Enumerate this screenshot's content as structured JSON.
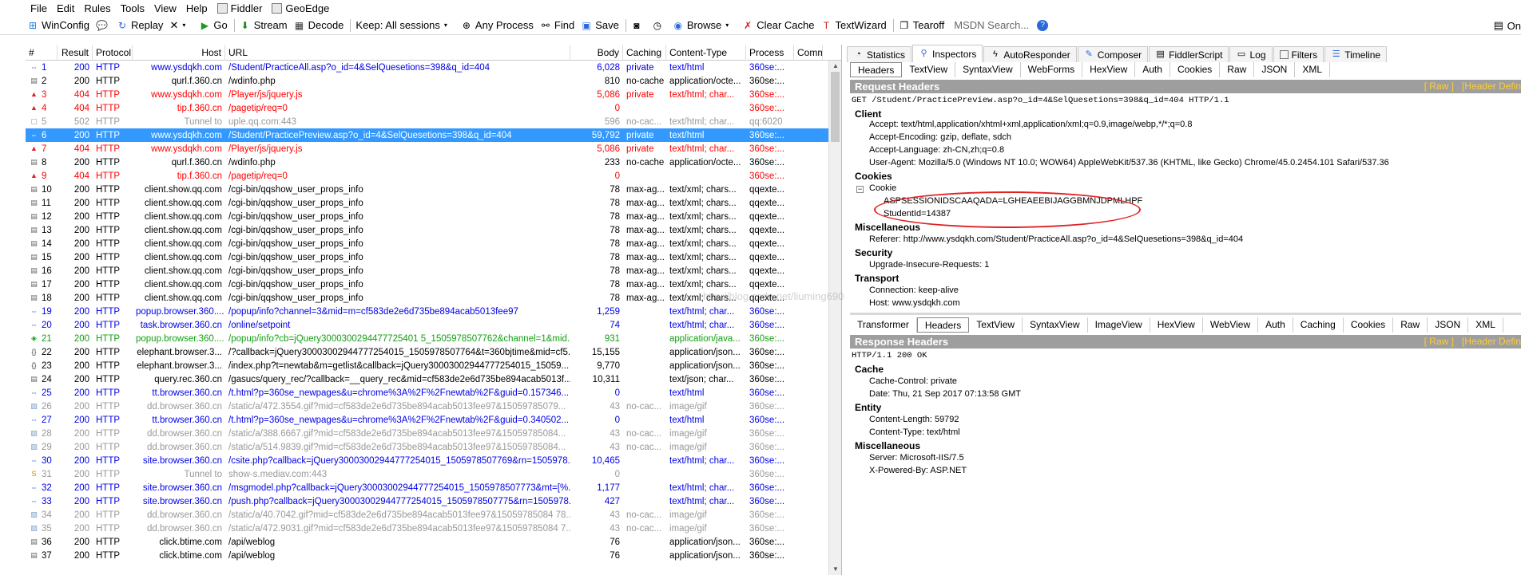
{
  "menu": [
    "File",
    "Edit",
    "Rules",
    "Tools",
    "View",
    "Help",
    "Fiddler",
    "GeoEdge"
  ],
  "toolbar": {
    "winconfig": "WinConfig",
    "replay": "Replay",
    "remove": "✕",
    "go": "Go",
    "stream": "Stream",
    "decode": "Decode",
    "keep": "Keep: All sessions",
    "any_process": "Any Process",
    "find": "Find",
    "save": "Save",
    "browse": "Browse",
    "clear_cache": "Clear Cache",
    "textwizard": "TextWizard",
    "tearoff": "Tearoff",
    "msdn_search": "MSDN Search...",
    "online": "On"
  },
  "sessions": {
    "columns": [
      "#",
      "Result",
      "Protocol",
      "Host",
      "URL",
      "Body",
      "Caching",
      "Content-Type",
      "Process",
      "Comm"
    ],
    "rows": [
      {
        "num": "1",
        "result": "200",
        "proto": "HTTP",
        "host": "www.ysdqkh.com",
        "url": "/Student/PracticeAll.asp?o_id=4&SelQuesetions=398&q_id=404",
        "body": "6,028",
        "caching": "private",
        "ctype": "text/html",
        "proc": "360se:...",
        "color": "blue",
        "icon": "arrows"
      },
      {
        "num": "2",
        "result": "200",
        "proto": "HTTP",
        "host": "qurl.f.360.cn",
        "url": "/wdinfo.php",
        "body": "810",
        "caching": "no-cache",
        "ctype": "application/octe...",
        "proc": "360se:...",
        "color": "black",
        "icon": "doc"
      },
      {
        "num": "3",
        "result": "404",
        "proto": "HTTP",
        "host": "www.ysdqkh.com",
        "url": "/Player/js/jquery.js",
        "body": "5,086",
        "caching": "private",
        "ctype": "text/html; char...",
        "proc": "360se:...",
        "color": "red",
        "icon": "warn"
      },
      {
        "num": "4",
        "result": "404",
        "proto": "HTTP",
        "host": "tip.f.360.cn",
        "url": "/pagetip/req=0",
        "body": "0",
        "caching": "",
        "ctype": "",
        "proc": "360se:...",
        "color": "red",
        "icon": "warn"
      },
      {
        "num": "5",
        "result": "502",
        "proto": "HTTP",
        "host": "Tunnel to",
        "url": "uple.qq.com:443",
        "body": "596",
        "caching": "no-cac...",
        "ctype": "text/html; char...",
        "proc": "qq:6020",
        "color": "gray",
        "icon": "lock"
      },
      {
        "num": "6",
        "result": "200",
        "proto": "HTTP",
        "host": "www.ysdqkh.com",
        "url": "/Student/PracticePreview.asp?o_id=4&SelQuesetions=398&q_id=404",
        "body": "59,792",
        "caching": "private",
        "ctype": "text/html",
        "proc": "360se:...",
        "color": "sel",
        "icon": "arrows"
      },
      {
        "num": "7",
        "result": "404",
        "proto": "HTTP",
        "host": "www.ysdqkh.com",
        "url": "/Player/js/jquery.js",
        "body": "5,086",
        "caching": "private",
        "ctype": "text/html; char...",
        "proc": "360se:...",
        "color": "red",
        "icon": "warn"
      },
      {
        "num": "8",
        "result": "200",
        "proto": "HTTP",
        "host": "qurl.f.360.cn",
        "url": "/wdinfo.php",
        "body": "233",
        "caching": "no-cache",
        "ctype": "application/octe...",
        "proc": "360se:...",
        "color": "black",
        "icon": "doc"
      },
      {
        "num": "9",
        "result": "404",
        "proto": "HTTP",
        "host": "tip.f.360.cn",
        "url": "/pagetip/req=0",
        "body": "0",
        "caching": "",
        "ctype": "",
        "proc": "360se:...",
        "color": "red",
        "icon": "warn"
      },
      {
        "num": "10",
        "result": "200",
        "proto": "HTTP",
        "host": "client.show.qq.com",
        "url": "/cgi-bin/qqshow_user_props_info",
        "body": "78",
        "caching": "max-ag...",
        "ctype": "text/xml; chars...",
        "proc": "qqexte...",
        "color": "black",
        "icon": "doc"
      },
      {
        "num": "11",
        "result": "200",
        "proto": "HTTP",
        "host": "client.show.qq.com",
        "url": "/cgi-bin/qqshow_user_props_info",
        "body": "78",
        "caching": "max-ag...",
        "ctype": "text/xml; chars...",
        "proc": "qqexte...",
        "color": "black",
        "icon": "doc"
      },
      {
        "num": "12",
        "result": "200",
        "proto": "HTTP",
        "host": "client.show.qq.com",
        "url": "/cgi-bin/qqshow_user_props_info",
        "body": "78",
        "caching": "max-ag...",
        "ctype": "text/xml; chars...",
        "proc": "qqexte...",
        "color": "black",
        "icon": "doc"
      },
      {
        "num": "13",
        "result": "200",
        "proto": "HTTP",
        "host": "client.show.qq.com",
        "url": "/cgi-bin/qqshow_user_props_info",
        "body": "78",
        "caching": "max-ag...",
        "ctype": "text/xml; chars...",
        "proc": "qqexte...",
        "color": "black",
        "icon": "doc"
      },
      {
        "num": "14",
        "result": "200",
        "proto": "HTTP",
        "host": "client.show.qq.com",
        "url": "/cgi-bin/qqshow_user_props_info",
        "body": "78",
        "caching": "max-ag...",
        "ctype": "text/xml; chars...",
        "proc": "qqexte...",
        "color": "black",
        "icon": "doc"
      },
      {
        "num": "15",
        "result": "200",
        "proto": "HTTP",
        "host": "client.show.qq.com",
        "url": "/cgi-bin/qqshow_user_props_info",
        "body": "78",
        "caching": "max-ag...",
        "ctype": "text/xml; chars...",
        "proc": "qqexte...",
        "color": "black",
        "icon": "doc"
      },
      {
        "num": "16",
        "result": "200",
        "proto": "HTTP",
        "host": "client.show.qq.com",
        "url": "/cgi-bin/qqshow_user_props_info",
        "body": "78",
        "caching": "max-ag...",
        "ctype": "text/xml; chars...",
        "proc": "qqexte...",
        "color": "black",
        "icon": "doc"
      },
      {
        "num": "17",
        "result": "200",
        "proto": "HTTP",
        "host": "client.show.qq.com",
        "url": "/cgi-bin/qqshow_user_props_info",
        "body": "78",
        "caching": "max-ag...",
        "ctype": "text/xml; chars...",
        "proc": "qqexte...",
        "color": "black",
        "icon": "doc"
      },
      {
        "num": "18",
        "result": "200",
        "proto": "HTTP",
        "host": "client.show.qq.com",
        "url": "/cgi-bin/qqshow_user_props_info",
        "body": "78",
        "caching": "max-ag...",
        "ctype": "text/xml; chars...",
        "proc": "qqexte...",
        "color": "black",
        "icon": "doc"
      },
      {
        "num": "19",
        "result": "200",
        "proto": "HTTP",
        "host": "popup.browser.360....",
        "url": "/popup/info?channel=3&mid=m=cf583de2e6d735be894acab5013fee97",
        "body": "1,259",
        "caching": "",
        "ctype": "text/html; char...",
        "proc": "360se:...",
        "color": "blue",
        "icon": "arrows"
      },
      {
        "num": "20",
        "result": "200",
        "proto": "HTTP",
        "host": "task.browser.360.cn",
        "url": "/online/setpoint",
        "body": "74",
        "caching": "",
        "ctype": "text/html; char...",
        "proc": "360se:...",
        "color": "blue",
        "icon": "arrows"
      },
      {
        "num": "21",
        "result": "200",
        "proto": "HTTP",
        "host": "popup.browser.360....",
        "url": "/popup/info?cb=jQuery3000300294477725401 5_1505978507762&channel=1&mid...",
        "body": "931",
        "caching": "",
        "ctype": "application/java...",
        "proc": "360se:...",
        "color": "green",
        "icon": "js"
      },
      {
        "num": "22",
        "result": "200",
        "proto": "HTTP",
        "host": "elephant.browser.3...",
        "url": "/?callback=jQuery30003002944777254015_1505978507764&t=360bjtime&mid=cf5...",
        "body": "15,155",
        "caching": "",
        "ctype": "application/json...",
        "proc": "360se:...",
        "color": "black",
        "icon": "json"
      },
      {
        "num": "23",
        "result": "200",
        "proto": "HTTP",
        "host": "elephant.browser.3...",
        "url": "/index.php?t=newtab&m=getlist&callback=jQuery30003002944777254015_15059...",
        "body": "9,770",
        "caching": "",
        "ctype": "application/json...",
        "proc": "360se:...",
        "color": "black",
        "icon": "json"
      },
      {
        "num": "24",
        "result": "200",
        "proto": "HTTP",
        "host": "query.rec.360.cn",
        "url": "/gasucs/query_rec/?callback=__query_rec&mid=cf583de2e6d735be894acab5013f...",
        "body": "10,311",
        "caching": "",
        "ctype": "text/json; char...",
        "proc": "360se:...",
        "color": "black",
        "icon": "doc"
      },
      {
        "num": "25",
        "result": "200",
        "proto": "HTTP",
        "host": "tt.browser.360.cn",
        "url": "/t.html?p=360se_newpages&u=chrome%3A%2F%2Fnewtab%2F&guid=0.157346...",
        "body": "0",
        "caching": "",
        "ctype": "text/html",
        "proc": "360se:...",
        "color": "blue",
        "icon": "arrows"
      },
      {
        "num": "26",
        "result": "200",
        "proto": "HTTP",
        "host": "dd.browser.360.cn",
        "url": "/static/a/472.3554.gif?mid=cf583de2e6d735be894acab5013fee97&15059785079...",
        "body": "43",
        "caching": "no-cac...",
        "ctype": "image/gif",
        "proc": "360se:...",
        "color": "gray",
        "icon": "img"
      },
      {
        "num": "27",
        "result": "200",
        "proto": "HTTP",
        "host": "tt.browser.360.cn",
        "url": "/t.html?p=360se_newpages&u=chrome%3A%2F%2Fnewtab%2F&guid=0.340502...",
        "body": "0",
        "caching": "",
        "ctype": "text/html",
        "proc": "360se:...",
        "color": "blue",
        "icon": "arrows"
      },
      {
        "num": "28",
        "result": "200",
        "proto": "HTTP",
        "host": "dd.browser.360.cn",
        "url": "/static/a/388.6667.gif?mid=cf583de2e6d735be894acab5013fee97&15059785084...",
        "body": "43",
        "caching": "no-cac...",
        "ctype": "image/gif",
        "proc": "360se:...",
        "color": "gray",
        "icon": "img"
      },
      {
        "num": "29",
        "result": "200",
        "proto": "HTTP",
        "host": "dd.browser.360.cn",
        "url": "/static/a/514.9839.gif?mid=cf583de2e6d735be894acab5013fee97&15059785084...",
        "body": "43",
        "caching": "no-cac...",
        "ctype": "image/gif",
        "proc": "360se:...",
        "color": "gray",
        "icon": "img"
      },
      {
        "num": "30",
        "result": "200",
        "proto": "HTTP",
        "host": "site.browser.360.cn",
        "url": "/csite.php?callback=jQuery30003002944777254015_1505978507769&rn=1505978...",
        "body": "10,465",
        "caching": "",
        "ctype": "text/html; char...",
        "proc": "360se:...",
        "color": "blue",
        "icon": "arrows"
      },
      {
        "num": "31",
        "result": "200",
        "proto": "HTTP",
        "host": "Tunnel to",
        "url": "show-s.mediav.com:443",
        "body": "0",
        "caching": "",
        "ctype": "",
        "proc": "360se:...",
        "color": "gray",
        "icon": "spdy"
      },
      {
        "num": "32",
        "result": "200",
        "proto": "HTTP",
        "host": "site.browser.360.cn",
        "url": "/msgmodel.php?callback=jQuery30003002944777254015_1505978507773&mt=[%...",
        "body": "1,177",
        "caching": "",
        "ctype": "text/html; char...",
        "proc": "360se:...",
        "color": "blue",
        "icon": "arrows"
      },
      {
        "num": "33",
        "result": "200",
        "proto": "HTTP",
        "host": "site.browser.360.cn",
        "url": "/push.php?callback=jQuery30003002944777254015_1505978507775&rn=1505978...",
        "body": "427",
        "caching": "",
        "ctype": "text/html; char...",
        "proc": "360se:...",
        "color": "blue",
        "icon": "arrows"
      },
      {
        "num": "34",
        "result": "200",
        "proto": "HTTP",
        "host": "dd.browser.360.cn",
        "url": "/static/a/40.7042.gif?mid=cf583de2e6d735be894acab5013fee97&15059785084 78...",
        "body": "43",
        "caching": "no-cac...",
        "ctype": "image/gif",
        "proc": "360se:...",
        "color": "gray",
        "icon": "img"
      },
      {
        "num": "35",
        "result": "200",
        "proto": "HTTP",
        "host": "dd.browser.360.cn",
        "url": "/static/a/472.9031.gif?mid=cf583de2e6d735be894acab5013fee97&15059785084 7...",
        "body": "43",
        "caching": "no-cac...",
        "ctype": "image/gif",
        "proc": "360se:...",
        "color": "gray",
        "icon": "img"
      },
      {
        "num": "36",
        "result": "200",
        "proto": "HTTP",
        "host": "click.btime.com",
        "url": "/api/weblog",
        "body": "76",
        "caching": "",
        "ctype": "application/json...",
        "proc": "360se:...",
        "color": "black",
        "icon": "doc"
      },
      {
        "num": "37",
        "result": "200",
        "proto": "HTTP",
        "host": "click.btime.com",
        "url": "/api/weblog",
        "body": "76",
        "caching": "",
        "ctype": "application/json...",
        "proc": "360se:...",
        "color": "black",
        "icon": "doc"
      }
    ]
  },
  "inspector": {
    "main_tabs": [
      "Statistics",
      "Inspectors",
      "AutoResponder",
      "Composer",
      "FiddlerScript",
      "Log",
      "Filters",
      "Timeline"
    ],
    "request_tabs": [
      "Headers",
      "TextView",
      "SyntaxView",
      "WebForms",
      "HexView",
      "Auth",
      "Cookies",
      "Raw",
      "JSON",
      "XML"
    ],
    "request_band": "Request Headers",
    "band_links": [
      "[ Raw ]",
      "[Header Defin"
    ],
    "request_line": "GET /Student/PracticePreview.asp?o_id=4&SelQuesetions=398&q_id=404 HTTP/1.1",
    "client_group": "Client",
    "client_lines": [
      "Accept: text/html,application/xhtml+xml,application/xml;q=0.9,image/webp,*/*;q=0.8",
      "Accept-Encoding: gzip, deflate, sdch",
      "Accept-Language: zh-CN,zh;q=0.8",
      "User-Agent: Mozilla/5.0 (Windows NT 10.0; WOW64) AppleWebKit/537.36 (KHTML, like Gecko) Chrome/45.0.2454.101 Safari/537.36"
    ],
    "cookies_group": "Cookies",
    "cookie_label": "Cookie",
    "cookie_lines": [
      "ASPSESSIONIDSCAAQADA=LGHEAEEBIJAGGBMNJDPMLHPF",
      "StudentId=14387"
    ],
    "misc_group": "Miscellaneous",
    "referer": "Referer: http://www.ysdqkh.com/Student/PracticeAll.asp?o_id=4&SelQuesetions=398&q_id=404",
    "security_group": "Security",
    "security_line": "Upgrade-Insecure-Requests: 1",
    "transport_group": "Transport",
    "transport_lines": [
      "Connection: keep-alive",
      "Host: www.ysdqkh.com"
    ],
    "response_tabs": [
      "Transformer",
      "Headers",
      "TextView",
      "SyntaxView",
      "ImageView",
      "HexView",
      "WebView",
      "Auth",
      "Caching",
      "Cookies",
      "Raw",
      "JSON",
      "XML"
    ],
    "response_band": "Response Headers",
    "response_line": "HTTP/1.1 200 OK",
    "cache_group": "Cache",
    "cache_lines": [
      "Cache-Control: private",
      "Date: Thu, 21 Sep 2017 07:13:58 GMT"
    ],
    "entity_group": "Entity",
    "entity_lines": [
      "Content-Length: 59792",
      "Content-Type: text/html"
    ],
    "resp_misc_group": "Miscellaneous",
    "resp_misc_lines": [
      "Server: Microsoft-IIS/7.5",
      "X-Powered-By: ASP.NET"
    ]
  },
  "watermark": "http://blog.csdn.net/liuming690",
  "colors": {
    "selected_row": "#3399ff",
    "link_blue": "#0000e8",
    "error_red": "#ff0000",
    "js_green": "#12a012",
    "band_gray": "#9e9e9e",
    "annotation_red": "#e02222"
  }
}
